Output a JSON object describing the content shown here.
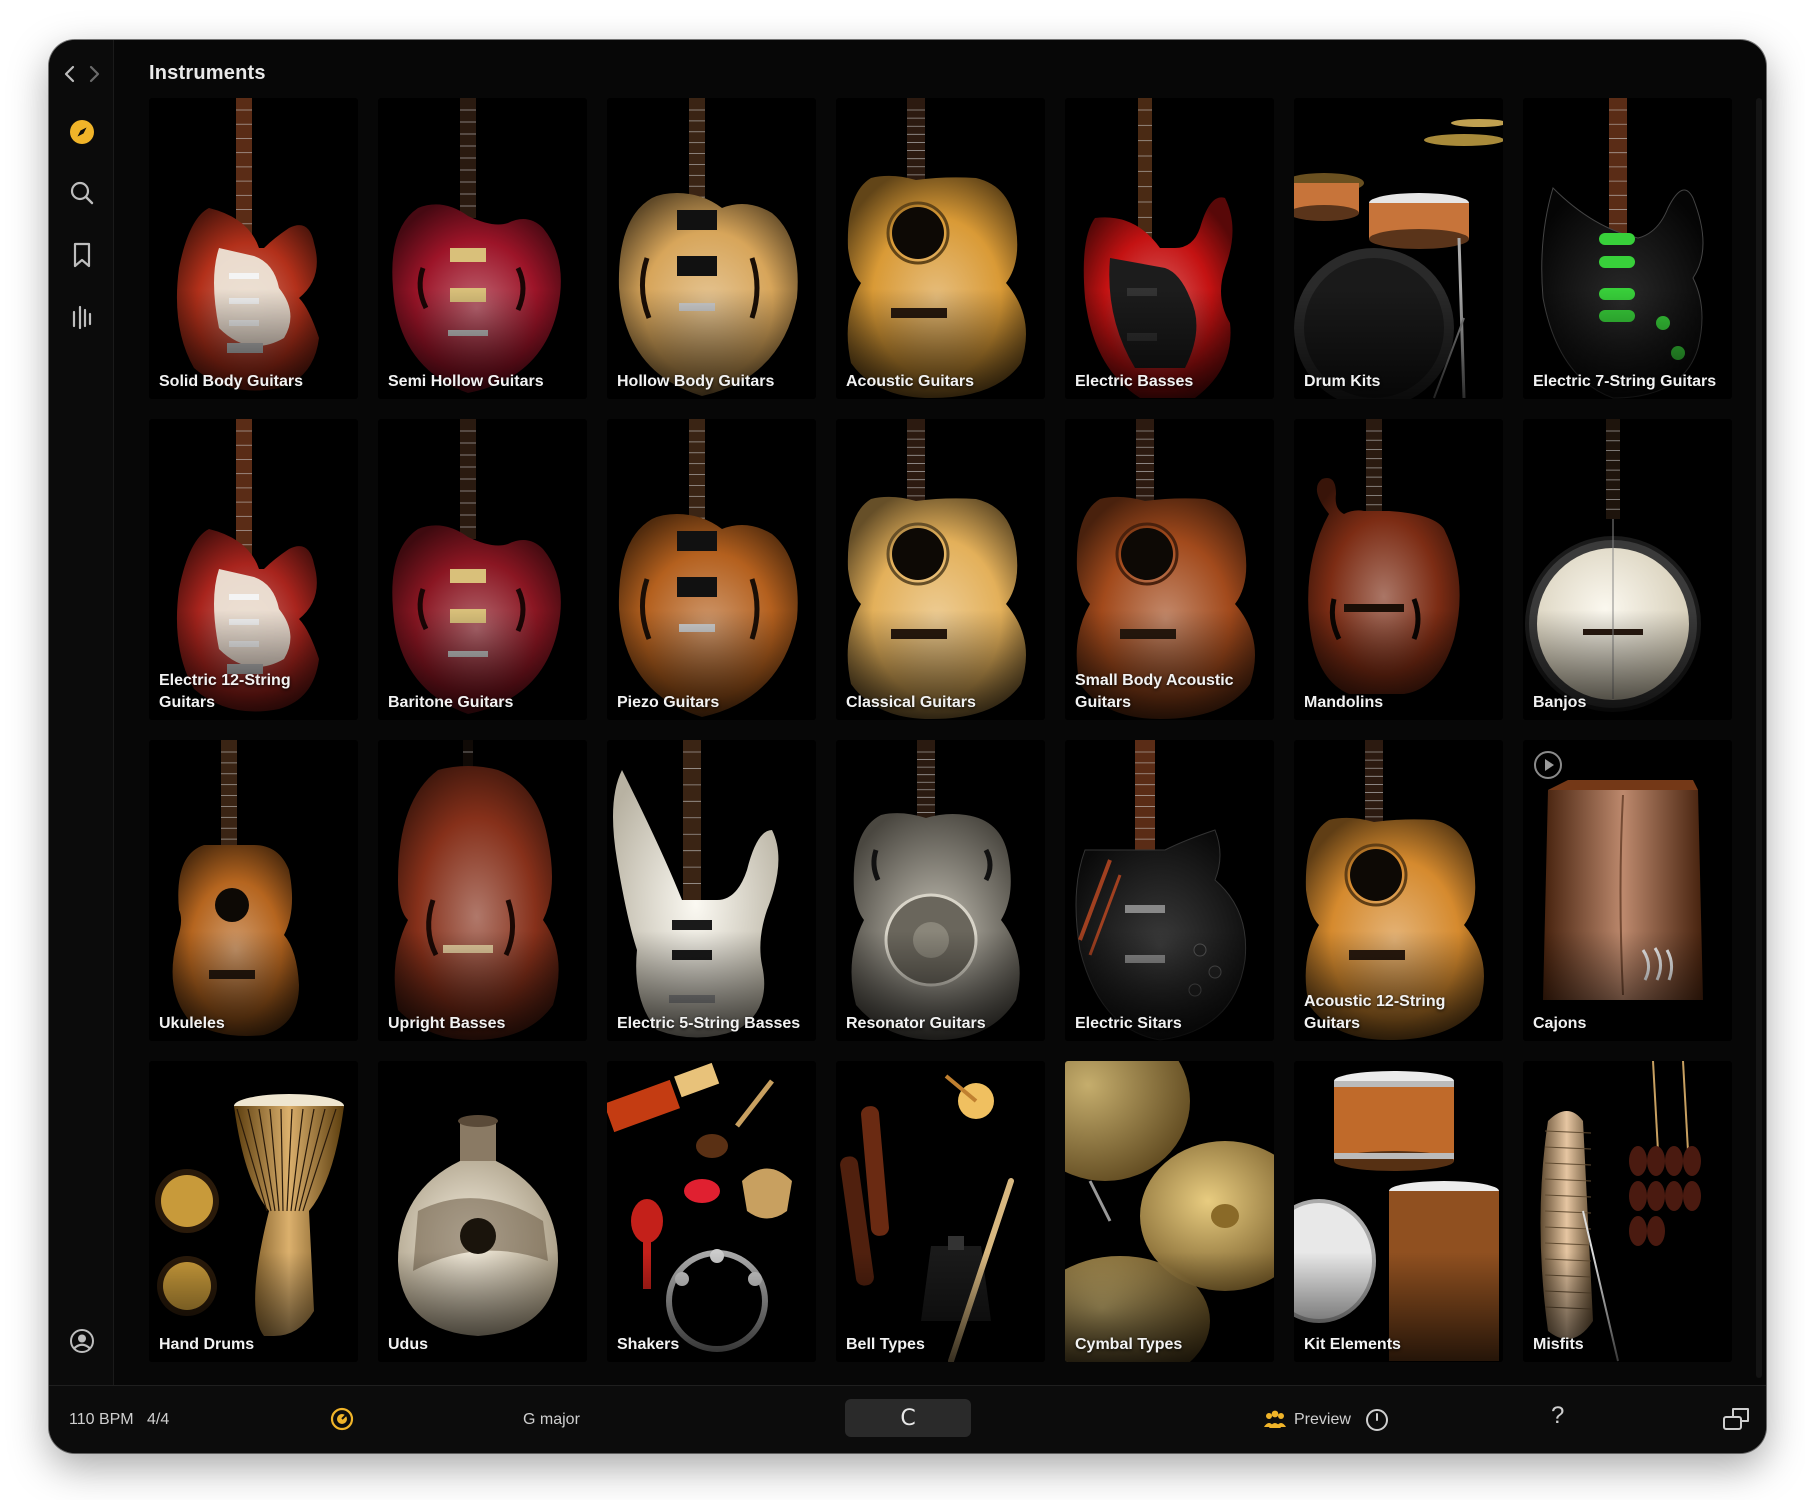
{
  "window": {
    "title": "Instruments"
  },
  "sidebar": {
    "items": [
      {
        "icon": "compass-icon",
        "active": true,
        "color": "#f0b429"
      },
      {
        "icon": "search-icon"
      },
      {
        "icon": "bookmark-icon"
      },
      {
        "icon": "mixer-icon"
      }
    ],
    "account_icon": "user-icon"
  },
  "instruments": [
    {
      "label": "Solid Body Guitars",
      "art": "strat",
      "color": "#b2301a"
    },
    {
      "label": "Semi Hollow Guitars",
      "art": "semi",
      "color": "#9c1428"
    },
    {
      "label": "Hollow Body Guitars",
      "art": "hollow",
      "color": "#d7a55a"
    },
    {
      "label": "Acoustic Guitars",
      "art": "acoustic",
      "color": "#d99a36"
    },
    {
      "label": "Electric Basses",
      "art": "bass",
      "color": "#c41212"
    },
    {
      "label": "Drum Kits",
      "art": "drums",
      "color": "#c7743a"
    },
    {
      "label": "Electric 7-String Guitars",
      "art": "seven",
      "color": "#161616"
    },
    {
      "label": "Electric 12-String Guitars",
      "art": "strat",
      "color": "#a8241d"
    },
    {
      "label": "Baritone Guitars",
      "art": "semi",
      "color": "#8a1622"
    },
    {
      "label": "Piezo Guitars",
      "art": "hollow",
      "color": "#b4601e"
    },
    {
      "label": "Classical Guitars",
      "art": "acoustic",
      "color": "#e3b05a"
    },
    {
      "label": "Small Body Acoustic Guitars",
      "art": "acoustic",
      "color": "#a24a1c"
    },
    {
      "label": "Mandolins",
      "art": "mandolin",
      "color": "#7c2c14"
    },
    {
      "label": "Banjos",
      "art": "banjo",
      "color": "#e8e2cf"
    },
    {
      "label": "Ukuleles",
      "art": "uke",
      "color": "#b5651f"
    },
    {
      "label": "Upright Basses",
      "art": "upright",
      "color": "#86301a"
    },
    {
      "label": "Electric 5-String Basses",
      "art": "whitebass",
      "color": "#ece8dc"
    },
    {
      "label": "Resonator Guitars",
      "art": "resonator",
      "color": "#8e8a80"
    },
    {
      "label": "Electric Sitars",
      "art": "sitar",
      "color": "#1c1c1c"
    },
    {
      "label": "Acoustic 12-String Guitars",
      "art": "acoustic",
      "color": "#d58a2e"
    },
    {
      "label": "Cajons",
      "art": "cajon",
      "color": "#9a4a1e",
      "play_icon": "play-icon"
    },
    {
      "label": "Hand Drums",
      "art": "handdrums",
      "color": "#c8861e"
    },
    {
      "label": "Udus",
      "art": "udu",
      "color": "#e6dac4"
    },
    {
      "label": "Shakers",
      "art": "shakers",
      "color": "#c4201a"
    },
    {
      "label": "Bell Types",
      "art": "bells",
      "color": "#6a2a12"
    },
    {
      "label": "Cymbal Types",
      "art": "cymbals",
      "color": "#a8883a"
    },
    {
      "label": "Kit Elements",
      "art": "kit",
      "color": "#c06a2a"
    },
    {
      "label": "Misfits",
      "art": "misfits",
      "color": "#d8a870"
    }
  ],
  "status_bar": {
    "tempo": "110 BPM",
    "time_signature": "4/4",
    "tuner_icon": "tuner-icon",
    "key": "G major",
    "center_button_icon": "loop-icon",
    "center_button_label": "C",
    "preview_label": "Preview",
    "help_label": "?"
  }
}
